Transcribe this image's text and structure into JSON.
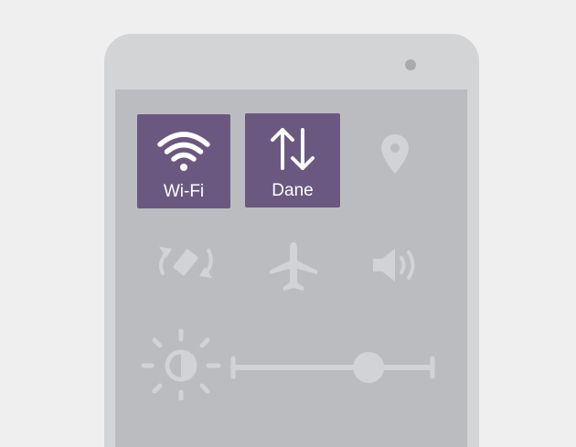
{
  "quick_settings": {
    "wifi": {
      "label": "Wi-Fi",
      "icon": "wifi-icon",
      "active": true
    },
    "data": {
      "label": "Dane",
      "icon": "data-arrows-icon",
      "active": true
    },
    "location": {
      "icon": "location-icon",
      "active": false
    },
    "auto_rotate": {
      "icon": "auto-rotate-icon",
      "active": false
    },
    "airplane": {
      "icon": "airplane-icon",
      "active": false
    },
    "sound": {
      "icon": "speaker-icon",
      "active": false
    },
    "brightness": {
      "icon": "brightness-icon",
      "level": 0.68
    }
  },
  "colors": {
    "active_tile": "#6b5880",
    "inactive_icon": "#d2d3d6",
    "screen": "#bbbcc0",
    "device": "#d3d4d6",
    "background": "#efefef"
  }
}
